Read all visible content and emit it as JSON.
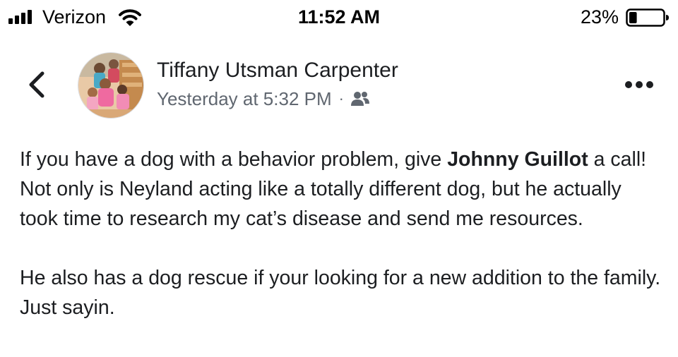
{
  "status_bar": {
    "carrier": "Verizon",
    "time": "11:52 AM",
    "battery_percent": "23%",
    "battery_level": 0.23,
    "signal_icon": "signal-bars-icon",
    "wifi_icon": "wifi-icon",
    "battery_icon": "battery-icon"
  },
  "header": {
    "back_icon": "chevron-left-icon",
    "author_name": "Tiffany Utsman Carpenter",
    "timestamp": "Yesterday at 5:32 PM",
    "separator": "·",
    "audience_icon": "friends-icon",
    "more_icon": "more-horizontal-icon"
  },
  "post": {
    "paragraph1_before": "If you have a dog with a behavior problem, give ",
    "mention": "Johnny Guillot",
    "paragraph1_after": " a call!  Not only is Neyland acting like a totally different dog, but he actually took time to research my cat’s disease and send me resources.",
    "paragraph2": "He also has a dog rescue if your looking for a new addition to the family. Just sayin."
  }
}
